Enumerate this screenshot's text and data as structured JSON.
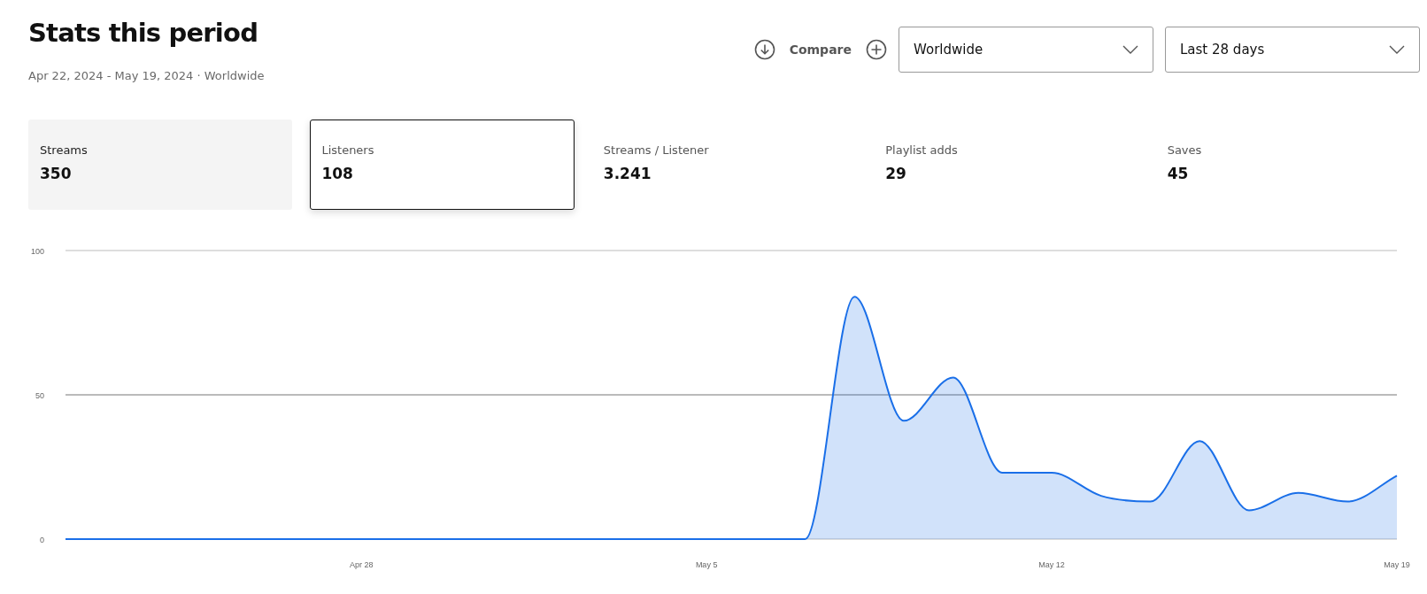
{
  "header": {
    "title": "Stats this period",
    "subtitle": "Apr 22, 2024 - May 19, 2024 · Worldwide"
  },
  "controls": {
    "compare": "Compare",
    "dropdowns": [
      {
        "value": "Worldwide"
      },
      {
        "value": "Last 28 days"
      }
    ]
  },
  "metrics": [
    {
      "label": "Streams",
      "value": "350",
      "selected": false,
      "hovered": true
    },
    {
      "label": "Listeners",
      "value": "108",
      "selected": true,
      "hovered": false
    },
    {
      "label": "Streams / Listener",
      "value": "3.241",
      "selected": false,
      "hovered": false
    },
    {
      "label": "Playlist adds",
      "value": "29",
      "selected": false,
      "hovered": false
    },
    {
      "label": "Saves",
      "value": "45",
      "selected": false,
      "hovered": false
    }
  ],
  "chart": {
    "chart_data": {
      "type": "area",
      "categories": [
        null,
        null,
        null,
        null,
        null,
        null,
        "Apr 28",
        null,
        null,
        null,
        null,
        null,
        null,
        "May 5",
        null,
        null,
        null,
        null,
        null,
        null,
        "May 12",
        null,
        null,
        null,
        null,
        null,
        null,
        "May 19"
      ],
      "series": [
        {
          "color": "#1a6fe8",
          "values": [
            0,
            0,
            0,
            0,
            0,
            0,
            0,
            0,
            0,
            0,
            0,
            0,
            0,
            0,
            0,
            0,
            84,
            41,
            56,
            23,
            23,
            15,
            13,
            34,
            10,
            16,
            13,
            22
          ]
        }
      ],
      "ylim": [
        0,
        100
      ],
      "yticks": [
        0,
        50,
        100
      ]
    }
  }
}
